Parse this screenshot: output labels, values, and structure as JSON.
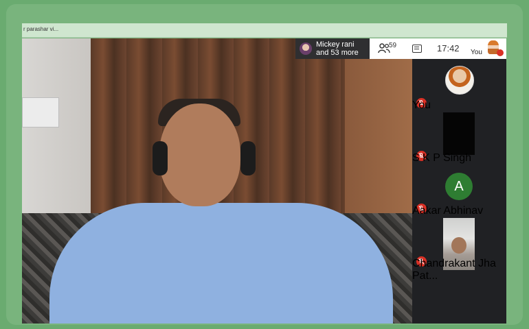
{
  "window": {
    "title": "r parashar vi..."
  },
  "header": {
    "presenter_line1": "Mickey rani",
    "presenter_line2": "and 53 more",
    "participant_count": "59",
    "time": "17:42",
    "self_label": "You"
  },
  "participants": [
    {
      "name": "You",
      "muted": true,
      "tile": "avatar-image"
    },
    {
      "name": "S K P Singh",
      "muted": true,
      "tile": "video"
    },
    {
      "name": "Aakar Abhinav",
      "muted": true,
      "tile": "letter",
      "letter": "A"
    },
    {
      "name": "Chandrakant Jha Pat...",
      "muted": true,
      "tile": "video"
    }
  ],
  "colors": {
    "accent_green": "#6aab70",
    "mute_red": "#d93025",
    "avatar_green": "#2e7d32"
  }
}
